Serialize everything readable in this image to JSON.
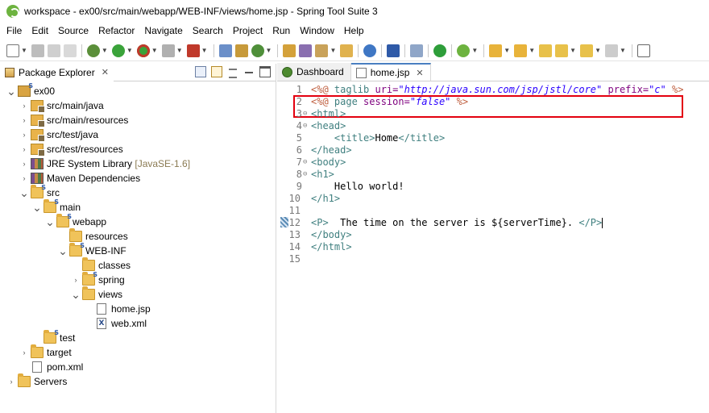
{
  "window": {
    "title": "workspace - ex00/src/main/webapp/WEB-INF/views/home.jsp - Spring Tool Suite 3"
  },
  "menubar": {
    "items": [
      "File",
      "Edit",
      "Source",
      "Refactor",
      "Navigate",
      "Search",
      "Project",
      "Run",
      "Window",
      "Help"
    ]
  },
  "package_explorer": {
    "title": "Package Explorer",
    "close": "✕",
    "tree": [
      {
        "label": "ex00",
        "icon": "project-icon",
        "twisty": "open"
      },
      {
        "label": "src/main/java",
        "icon": "source-folder-icon",
        "twisty": "closed"
      },
      {
        "label": "src/main/resources",
        "icon": "source-folder-icon",
        "twisty": "closed"
      },
      {
        "label": "src/test/java",
        "icon": "source-folder-icon",
        "twisty": "closed"
      },
      {
        "label": "src/test/resources",
        "icon": "source-folder-icon",
        "twisty": "closed"
      },
      {
        "label": "JRE System Library",
        "suffix": "[JavaSE-1.6]",
        "icon": "library-icon",
        "twisty": "closed"
      },
      {
        "label": "Maven Dependencies",
        "icon": "library-icon",
        "twisty": "closed"
      },
      {
        "label": "src",
        "icon": "folder-icon",
        "twisty": "open"
      },
      {
        "label": "main",
        "icon": "folder-icon",
        "twisty": "open"
      },
      {
        "label": "webapp",
        "icon": "folder-icon",
        "twisty": "open"
      },
      {
        "label": "resources",
        "icon": "folder-icon",
        "twisty": "none"
      },
      {
        "label": "WEB-INF",
        "icon": "folder-icon",
        "twisty": "open"
      },
      {
        "label": "classes",
        "icon": "folder-icon",
        "twisty": "none"
      },
      {
        "label": "spring",
        "icon": "folder-icon",
        "twisty": "closed"
      },
      {
        "label": "views",
        "icon": "folder-icon",
        "twisty": "open"
      },
      {
        "label": "home.jsp",
        "icon": "jsp-file-icon",
        "twisty": "none"
      },
      {
        "label": "web.xml",
        "icon": "xml-file-icon",
        "twisty": "none"
      },
      {
        "label": "test",
        "icon": "folder-icon",
        "twisty": "none"
      },
      {
        "label": "target",
        "icon": "folder-icon",
        "twisty": "closed"
      },
      {
        "label": "pom.xml",
        "icon": "pom-file-icon",
        "twisty": "none"
      },
      {
        "label": "Servers",
        "icon": "folder-icon",
        "twisty": "closed"
      }
    ]
  },
  "editor": {
    "tabs": [
      {
        "label": "Dashboard",
        "icon": "dashboard-icon",
        "active": false
      },
      {
        "label": "home.jsp",
        "icon": "jsp-file-icon",
        "active": true
      }
    ],
    "close": "✕",
    "lines": [
      {
        "n": "1",
        "fold": "",
        "segments": [
          {
            "t": "<%@ ",
            "c": "c-dir"
          },
          {
            "t": "taglib ",
            "c": "c-tag"
          },
          {
            "t": "uri=",
            "c": "c-attr"
          },
          {
            "t": "\"http://java.sun.com/jsp/jstl/core\"",
            "c": "c-str"
          },
          {
            "t": " prefix=",
            "c": "c-attr"
          },
          {
            "t": "\"c\"",
            "c": "c-str"
          },
          {
            "t": " %>",
            "c": "c-dir"
          }
        ]
      },
      {
        "n": "2",
        "fold": "",
        "segments": [
          {
            "t": "<%@ ",
            "c": "c-dir"
          },
          {
            "t": "page ",
            "c": "c-tag"
          },
          {
            "t": "session=",
            "c": "c-attr"
          },
          {
            "t": "\"false\"",
            "c": "c-str"
          },
          {
            "t": " %>",
            "c": "c-dir"
          }
        ]
      },
      {
        "n": "3",
        "fold": "⊖",
        "segments": [
          {
            "t": "<html>",
            "c": "c-tag"
          }
        ]
      },
      {
        "n": "4",
        "fold": "⊖",
        "segments": [
          {
            "t": "<head>",
            "c": "c-tag"
          }
        ]
      },
      {
        "n": "5",
        "fold": "",
        "segments": [
          {
            "t": "    <title>",
            "c": "c-tag"
          },
          {
            "t": "Home",
            "c": "c-plain"
          },
          {
            "t": "</title>",
            "c": "c-tag"
          }
        ]
      },
      {
        "n": "6",
        "fold": "",
        "segments": [
          {
            "t": "</head>",
            "c": "c-tag"
          }
        ]
      },
      {
        "n": "7",
        "fold": "⊖",
        "segments": [
          {
            "t": "<body>",
            "c": "c-tag"
          }
        ]
      },
      {
        "n": "8",
        "fold": "⊖",
        "segments": [
          {
            "t": "<h1>",
            "c": "c-tag"
          }
        ]
      },
      {
        "n": "9",
        "fold": "",
        "segments": [
          {
            "t": "    Hello world!",
            "c": "c-plain"
          }
        ]
      },
      {
        "n": "10",
        "fold": "",
        "segments": [
          {
            "t": "</h1>",
            "c": "c-tag"
          }
        ]
      },
      {
        "n": "11",
        "fold": "",
        "segments": []
      },
      {
        "n": "12",
        "fold": "",
        "segments": [
          {
            "t": "<P>",
            "c": "c-tag"
          },
          {
            "t": "  The time on the server is ${serverTime}. ",
            "c": "c-plain"
          },
          {
            "t": "</P>",
            "c": "c-tag"
          }
        ]
      },
      {
        "n": "13",
        "fold": "",
        "segments": [
          {
            "t": "</body>",
            "c": "c-tag"
          }
        ]
      },
      {
        "n": "14",
        "fold": "",
        "segments": [
          {
            "t": "</html>",
            "c": "c-tag"
          }
        ]
      },
      {
        "n": "15",
        "fold": "",
        "segments": []
      }
    ]
  },
  "colors": {
    "highlight_box": "#e3000f",
    "active_tab_accent": "#4a7fc1"
  }
}
